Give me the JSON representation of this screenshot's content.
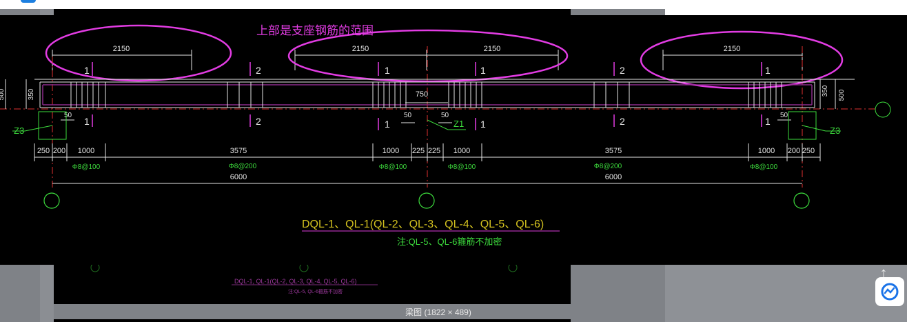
{
  "viewer": {
    "caption": "梁图 (1822 × 489)",
    "back_to_top_icon": "arrow-up-icon",
    "assistant_icon": "ai-assistant-icon"
  },
  "drawing": {
    "annotation": "上部是支座钢筋的范围",
    "top_dims": [
      "2150",
      "2150",
      "2150",
      "2150"
    ],
    "section_marks": [
      "1",
      "2",
      "1",
      "1",
      "2",
      "1"
    ],
    "height_dims": [
      "350",
      "500",
      "350",
      "500"
    ],
    "center_dim": "750",
    "small_dims": [
      "50",
      "50",
      "50",
      "50"
    ],
    "column_tags": [
      "Z3",
      "Z1",
      "Z3"
    ],
    "bottom_dims": [
      "250",
      "200",
      "1000",
      "3575",
      "1000",
      "225",
      "225",
      "1000",
      "3575",
      "1000",
      "200",
      "250"
    ],
    "stirrups": [
      "Φ8@100",
      "Φ8@200",
      "Φ8@100",
      "Φ8@100",
      "Φ8@200",
      "Φ8@100"
    ],
    "spans": [
      "6000",
      "6000"
    ],
    "title": "DQL-1、QL-1(QL-2、QL-3、QL-4、QL-5、QL-6)",
    "note": "注:QL-5、QL-6箍筋不加密",
    "thumb_title": "DQL-1, QL-1(QL-2, QL-3, QL-4, QL-5, QL-6)",
    "thumb_note": "注:QL-5, QL-6箍筋不加密"
  },
  "colors": {
    "magenta": "#e23ce3",
    "green": "#3ddc3d",
    "yellow": "#d4c21f",
    "white": "#e6e6e6",
    "red": "#e03030"
  }
}
